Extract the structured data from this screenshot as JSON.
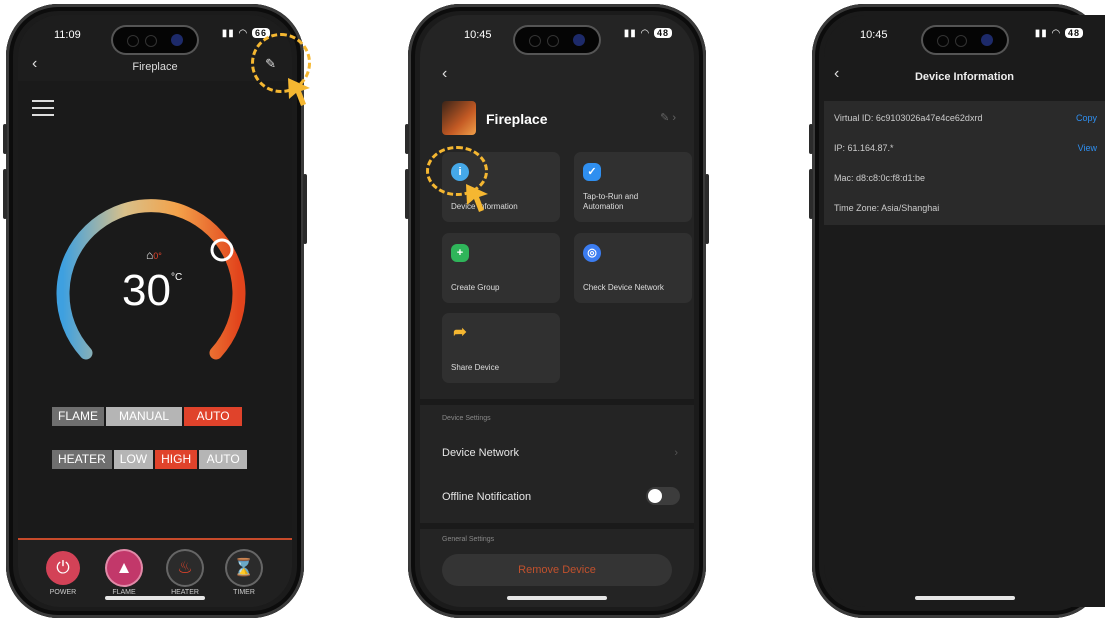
{
  "phone1": {
    "time": "11:09",
    "battery": "66",
    "title": "Fireplace",
    "temperature": "30",
    "temp_unit": "°C",
    "flame_row": {
      "label": "FLAME",
      "options": [
        "MANUAL",
        "AUTO"
      ],
      "selected": "AUTO"
    },
    "heater_row": {
      "label": "HEATER",
      "options": [
        "LOW",
        "HIGH",
        "AUTO"
      ],
      "selected": "HIGH"
    },
    "nav": [
      {
        "label": "POWER",
        "icon": "power-icon",
        "color": "#d34257"
      },
      {
        "label": "FLAME",
        "icon": "flame-icon",
        "color": "#c2386a"
      },
      {
        "label": "HEATER",
        "icon": "heater-icon",
        "color": "#2b2b2b"
      },
      {
        "label": "TIMER",
        "icon": "timer-icon",
        "color": "#2b2b2b"
      }
    ]
  },
  "phone2": {
    "time": "10:45",
    "battery": "48",
    "device_name": "Fireplace",
    "cards": [
      {
        "label": "Device Information",
        "icon": "info-icon",
        "color": "#45a8e8"
      },
      {
        "label": "Tap-to-Run and Automation",
        "icon": "check-icon",
        "color": "#2f8ff0"
      },
      {
        "label": "Create Group",
        "icon": "group-add-icon",
        "color": "#2fb55a"
      },
      {
        "label": "Check Device Network",
        "icon": "wifi-check-icon",
        "color": "#3b7cf0"
      },
      {
        "label": "Share Device",
        "icon": "share-icon",
        "color": "#f5b731"
      }
    ],
    "settings_header": "Device Settings",
    "device_network": "Device Network",
    "offline_notification": "Offline Notification",
    "other_header": "General Settings",
    "remove_button": "Remove Device"
  },
  "phone3": {
    "time": "10:45",
    "battery": "48",
    "title": "Device Information",
    "virtual_id": "Virtual ID: 6c9103026a47e4ce62dxrd",
    "copy": "Copy",
    "ip": "IP: 61.164.87.*",
    "view": "View",
    "mac": "Mac: d8:c8:0c:f8:d1:be",
    "time_zone": "Time Zone: Asia/Shanghai"
  },
  "colors": {
    "accent": "#f5b731",
    "hot": "#e0432b",
    "link": "#2f8ff0"
  }
}
